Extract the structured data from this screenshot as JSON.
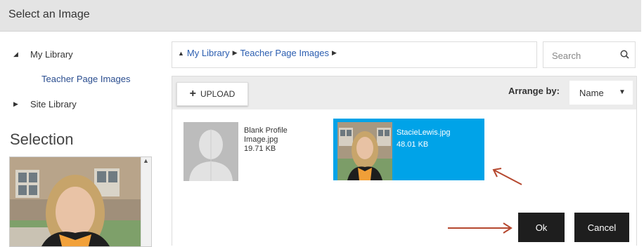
{
  "dialog": {
    "title": "Select an Image"
  },
  "tree": {
    "my_library": {
      "label": "My Library",
      "children": [
        {
          "label": "Teacher Page Images"
        }
      ]
    },
    "site_library": {
      "label": "Site Library"
    }
  },
  "selection": {
    "heading": "Selection"
  },
  "breadcrumb": {
    "items": [
      "My Library",
      "Teacher Page Images"
    ]
  },
  "search": {
    "placeholder": "Search"
  },
  "toolbar": {
    "upload_label": "UPLOAD",
    "arrange_label": "Arrange by:",
    "arrange_value": "Name"
  },
  "files": [
    {
      "name": "Blank Profile Image.jpg",
      "size": "19.71 KB",
      "selected": false
    },
    {
      "name": "StacieLewis.jpg",
      "size": "48.01 KB",
      "selected": true
    }
  ],
  "actions": {
    "ok_label": "Ok",
    "cancel_label": "Cancel"
  },
  "colors": {
    "selected_bg": "#00a3e8",
    "button_bg": "#1e1e1e",
    "arrow": "#b5482f",
    "link": "#2a5db0"
  }
}
